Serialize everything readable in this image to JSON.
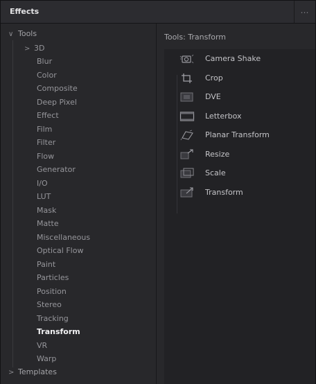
{
  "panel": {
    "title": "Effects",
    "menu_label": "…"
  },
  "tree": {
    "root": {
      "label": "Tools",
      "chevron": "∨"
    },
    "categories": [
      {
        "label": "3D",
        "has_children": true
      },
      {
        "label": "Blur"
      },
      {
        "label": "Color"
      },
      {
        "label": "Composite"
      },
      {
        "label": "Deep Pixel"
      },
      {
        "label": "Effect"
      },
      {
        "label": "Film"
      },
      {
        "label": "Filter"
      },
      {
        "label": "Flow"
      },
      {
        "label": "Generator"
      },
      {
        "label": "I/O"
      },
      {
        "label": "LUT"
      },
      {
        "label": "Mask"
      },
      {
        "label": "Matte"
      },
      {
        "label": "Miscellaneous"
      },
      {
        "label": "Optical Flow"
      },
      {
        "label": "Paint"
      },
      {
        "label": "Particles"
      },
      {
        "label": "Position"
      },
      {
        "label": "Stereo"
      },
      {
        "label": "Tracking"
      },
      {
        "label": "Transform",
        "selected": true
      },
      {
        "label": "VR"
      },
      {
        "label": "Warp"
      }
    ],
    "templates": {
      "label": "Templates",
      "chevron": ">"
    },
    "category_chevron": ">"
  },
  "content": {
    "title": "Tools: Transform",
    "tools": [
      {
        "label": "Camera Shake",
        "icon": "camera-shake-icon"
      },
      {
        "label": "Crop",
        "icon": "crop-icon"
      },
      {
        "label": "DVE",
        "icon": "dve-icon"
      },
      {
        "label": "Letterbox",
        "icon": "letterbox-icon"
      },
      {
        "label": "Planar Transform",
        "icon": "planar-transform-icon"
      },
      {
        "label": "Resize",
        "icon": "resize-icon"
      },
      {
        "label": "Scale",
        "icon": "scale-icon"
      },
      {
        "label": "Transform",
        "icon": "transform-icon"
      }
    ]
  },
  "colors": {
    "panel_bg": "#1f1f22",
    "header_bg": "#2c2c30",
    "selected_text": "#f2f2f4",
    "text": "#a4a4a8"
  }
}
